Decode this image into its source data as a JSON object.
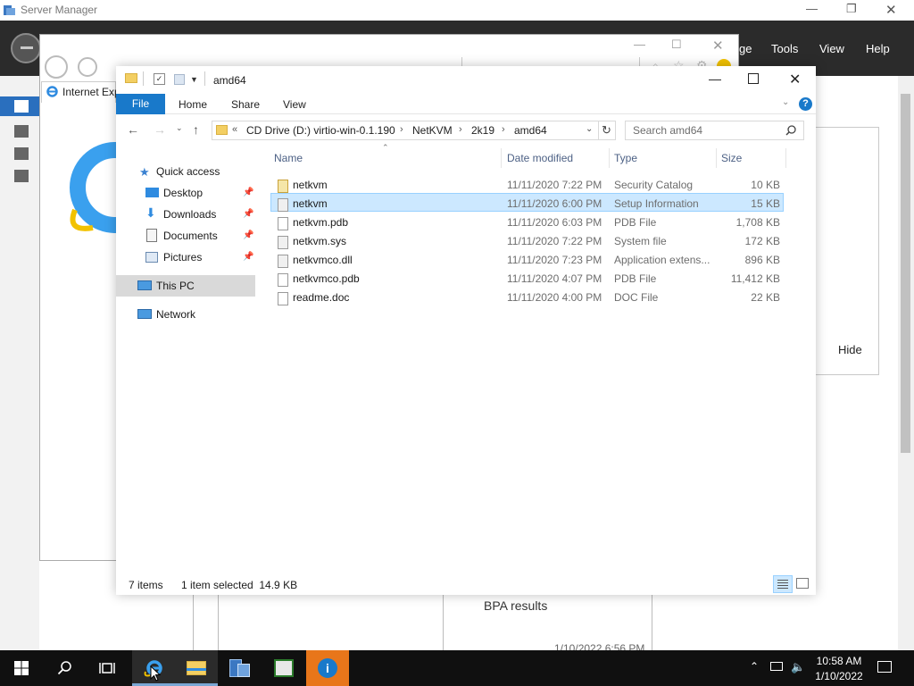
{
  "server_manager": {
    "title": "Server Manager",
    "menu": {
      "manage_partial": "ge",
      "tools": "Tools",
      "view": "View",
      "help": "Help"
    },
    "hide_label": "Hide",
    "bpa_results": "BPA results",
    "partial_date": "1/10/2022 6:56 PM"
  },
  "ie": {
    "tab_label": "Internet Exp"
  },
  "explorer": {
    "title": "amd64",
    "ribbon_tabs": [
      "File",
      "Home",
      "Share",
      "View"
    ],
    "breadcrumb": {
      "overflow": "«",
      "items": [
        "CD Drive (D:) virtio-win-0.1.190",
        "NetKVM",
        "2k19",
        "amd64"
      ]
    },
    "search_placeholder": "Search amd64",
    "nav": {
      "quick_access": "Quick access",
      "desktop": "Desktop",
      "downloads": "Downloads",
      "documents": "Documents",
      "pictures": "Pictures",
      "this_pc": "This PC",
      "network": "Network"
    },
    "columns": {
      "name": "Name",
      "date": "Date modified",
      "type": "Type",
      "size": "Size"
    },
    "files": [
      {
        "name": "netkvm",
        "date": "11/11/2020 7:22 PM",
        "type": "Security Catalog",
        "size": "10 KB",
        "icon": "security-catalog-icon"
      },
      {
        "name": "netkvm",
        "date": "11/11/2020 6:00 PM",
        "type": "Setup Information",
        "size": "15 KB",
        "icon": "setup-info-icon"
      },
      {
        "name": "netkvm.pdb",
        "date": "11/11/2020 6:03 PM",
        "type": "PDB File",
        "size": "1,708 KB",
        "icon": "blank-file-icon"
      },
      {
        "name": "netkvm.sys",
        "date": "11/11/2020 7:22 PM",
        "type": "System file",
        "size": "172 KB",
        "icon": "system-file-icon"
      },
      {
        "name": "netkvmco.dll",
        "date": "11/11/2020 7:23 PM",
        "type": "Application extens...",
        "size": "896 KB",
        "icon": "dll-file-icon"
      },
      {
        "name": "netkvmco.pdb",
        "date": "11/11/2020 4:07 PM",
        "type": "PDB File",
        "size": "11,412 KB",
        "icon": "blank-file-icon"
      },
      {
        "name": "readme.doc",
        "date": "11/11/2020 4:00 PM",
        "type": "DOC File",
        "size": "22 KB",
        "icon": "blank-file-icon"
      }
    ],
    "selected_index": 1,
    "status": {
      "items": "7 items",
      "selected": "1 item selected  14.9 KB"
    }
  },
  "taskbar": {
    "time": "10:58 AM",
    "date": "1/10/2022"
  },
  "colors": {
    "accent": "#1979ca",
    "selection": "#cce8ff",
    "taskbar": "#101010",
    "header": "#2b2b2b"
  }
}
